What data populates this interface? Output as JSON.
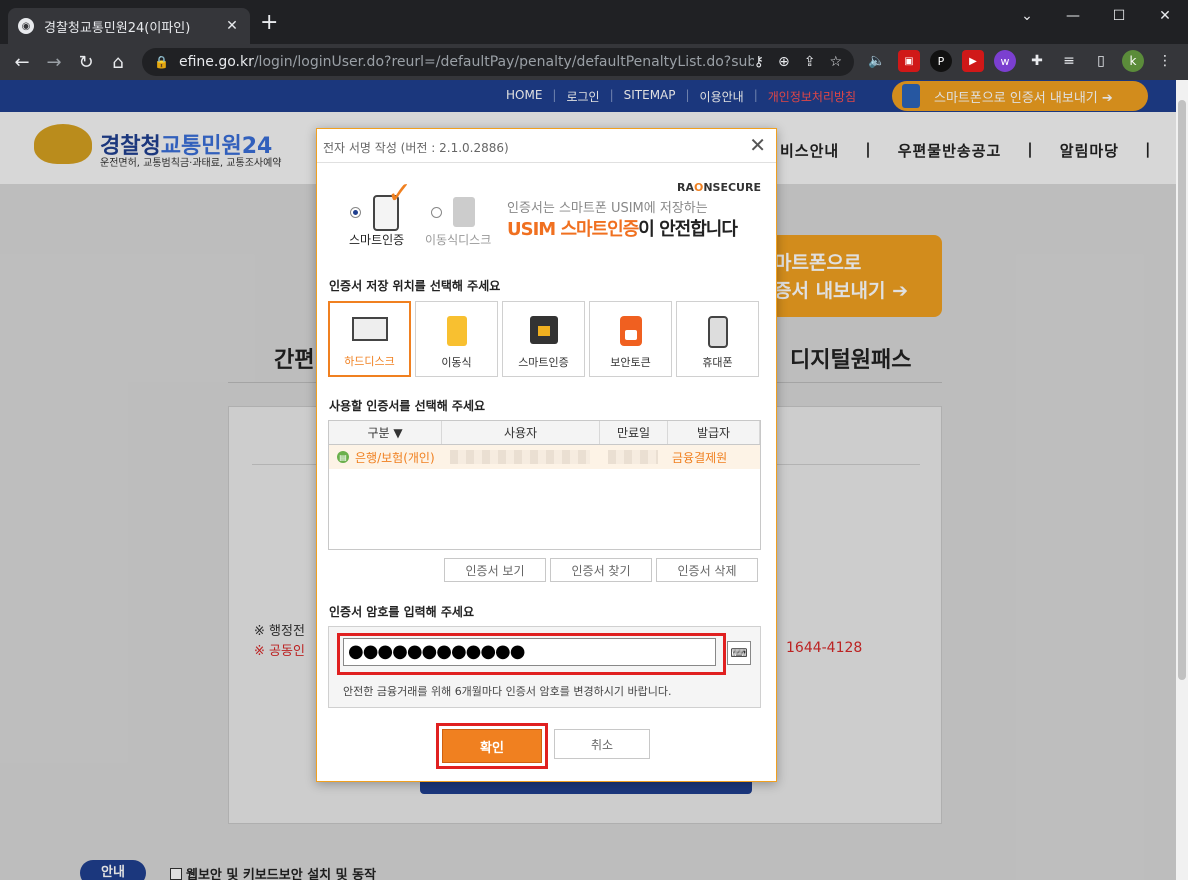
{
  "browser": {
    "tab_title": "경찰청교통민원24(이파인)",
    "tab_close": "✕",
    "new_tab": "+",
    "url_host": "efine.go.kr",
    "url_path": "/login/loginUser.do?reurl=/defaultPay/penalty/defaultPenaltyList.do?subM...",
    "profile_initial": "k",
    "window_min": "⌄",
    "window_minimize": "—",
    "window_restore": "☐",
    "window_close": "✕"
  },
  "site": {
    "top_links": [
      "HOME",
      "로그인",
      "SITEMAP",
      "이용안내"
    ],
    "top_red_link": "개인정보처리방침",
    "smart_export_btn": "스마트폰으로 인증서 내보내기 ➔",
    "logo_title": "경찰청",
    "logo_title_blue": "교통민원24",
    "logo_subtitle": "운전면허, 교통범칙금·과태료, 교통조사예약",
    "menu": [
      "비스안내",
      "우편물반송공고",
      "알림마당"
    ],
    "banner_line1": "마트폰으로",
    "banner_line2": "증서 내보내기  ➔",
    "tab_easy": "간편",
    "tab_digital": "디지털원패스",
    "note1": "※ 행정전",
    "note2": "※ 공동인",
    "phone": "1644-4128",
    "guide_pill": "안내",
    "guide_text": "웹보안 및 키보드보안 설치 및 동작"
  },
  "dialog": {
    "title": "전자 서명 작성 (버전 : 2.1.0.2886)",
    "close": "✕",
    "mode_smart": "스마트인증",
    "mode_removable": "이동식디스크",
    "brand_prefix": "RA",
    "brand_o": "O",
    "brand_suffix": "NSECURE",
    "slogan_line1": "인증서는 스마트폰 USIM에 저장하는",
    "slogan_line2_highlight": "USIM 스마트인증",
    "slogan_line2_rest": "이 안전합니다",
    "storage_title": "인증서 저장 위치를 선택해 주세요",
    "devices": [
      {
        "label": "하드디스크",
        "icon": "hard-disk-icon"
      },
      {
        "label": "이동식",
        "icon": "usb-icon"
      },
      {
        "label": "스마트인증",
        "icon": "sim-card-icon"
      },
      {
        "label": "보안토큰",
        "icon": "security-token-icon"
      },
      {
        "label": "휴대폰",
        "icon": "mobile-phone-icon"
      }
    ],
    "cert_select_title": "사용할 인증서를 선택해 주세요",
    "columns": [
      "구분 ▼",
      "사용자",
      "만료일",
      "발급자"
    ],
    "cert_row": {
      "type": "은행/보험(개인)",
      "issuer": "금융결제원"
    },
    "cert_buttons": [
      "인증서 보기",
      "인증서 찾기",
      "인증서 삭제"
    ],
    "password_title": "인증서 암호를 입력해 주세요",
    "password_value": "●●●●●●●●●●●●",
    "password_hint": "안전한 금융거래를 위해 6개월마다 인증서 암호를 변경하시기 바랍니다.",
    "ok": "확인",
    "cancel": "취소"
  }
}
